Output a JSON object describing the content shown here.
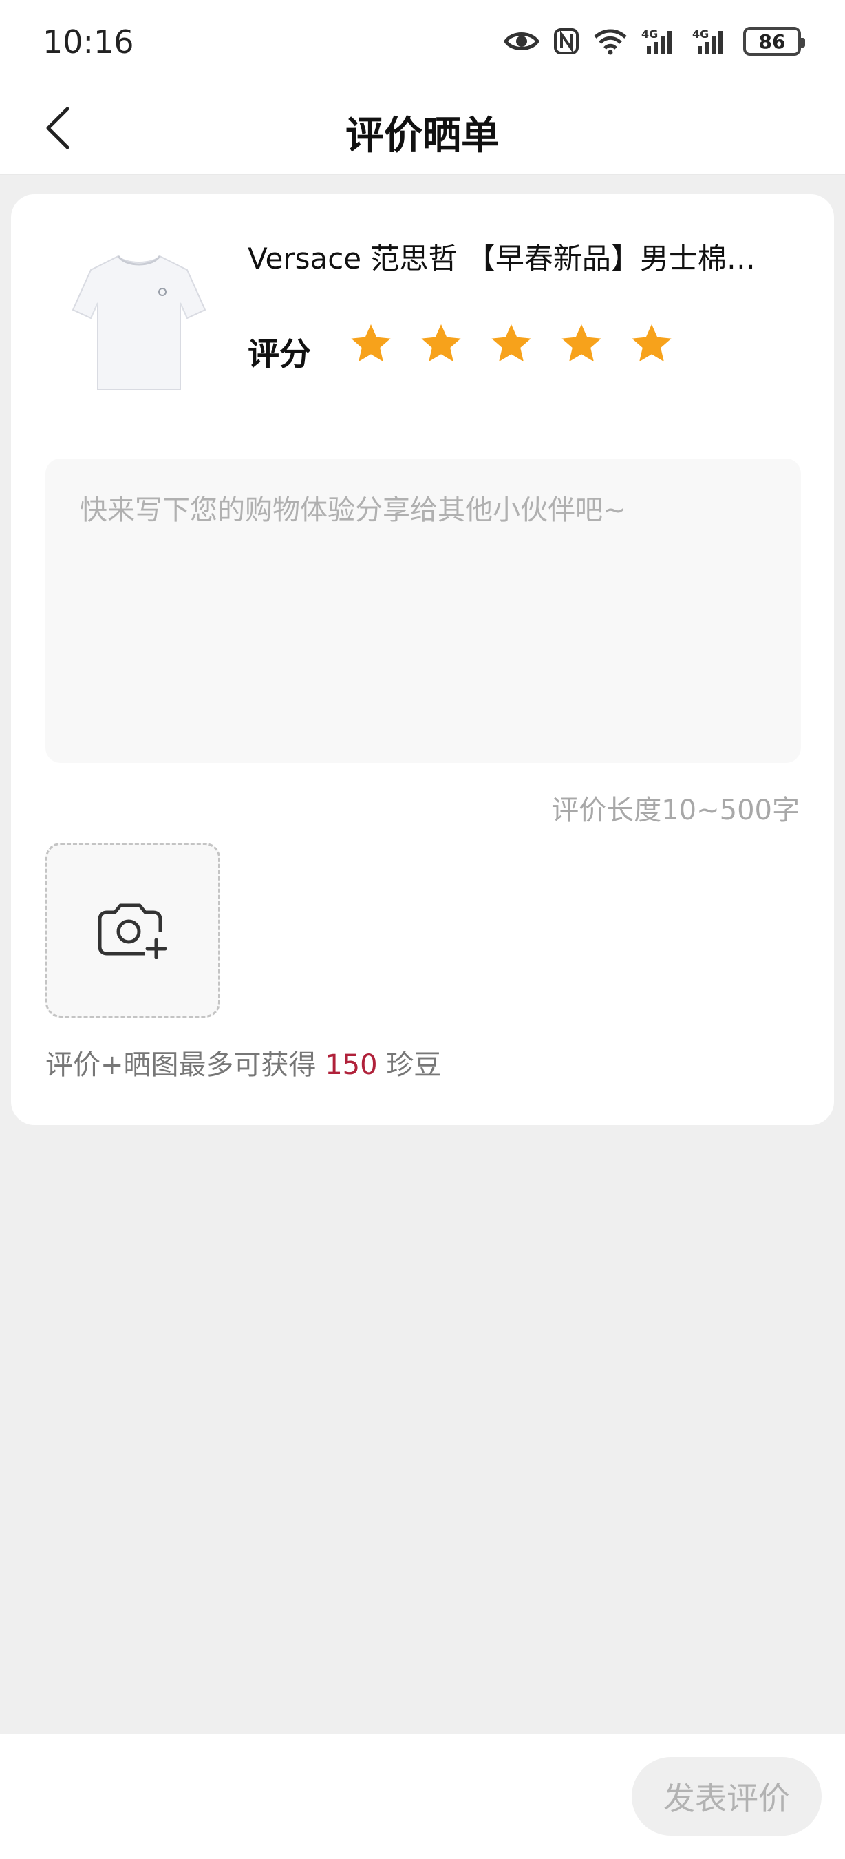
{
  "status_bar": {
    "time": "10:16",
    "battery": "86",
    "icons": [
      "eye-icon",
      "nfc-icon",
      "wifi-icon",
      "signal-4g-icon",
      "signal-4g-icon",
      "battery-icon"
    ]
  },
  "header": {
    "title": "评价晒单",
    "back_icon": "chevron-left-icon"
  },
  "product": {
    "name": "Versace 范思哲 【早春新品】男士棉…",
    "image": "white-tshirt-image"
  },
  "rating": {
    "label": "评分",
    "value": 5,
    "max": 5,
    "star_color": "#f7a21b"
  },
  "review": {
    "placeholder": "快来写下您的购物体验分享给其他小伙伴吧~",
    "value": "",
    "length_hint": "评价长度10~500字"
  },
  "upload": {
    "icon": "camera-add-icon"
  },
  "reward": {
    "prefix": "评价+晒图最多可获得 ",
    "amount": "150",
    "suffix": " 珍豆",
    "amount_color": "#b0213a"
  },
  "footer": {
    "submit_label": "发表评价"
  }
}
